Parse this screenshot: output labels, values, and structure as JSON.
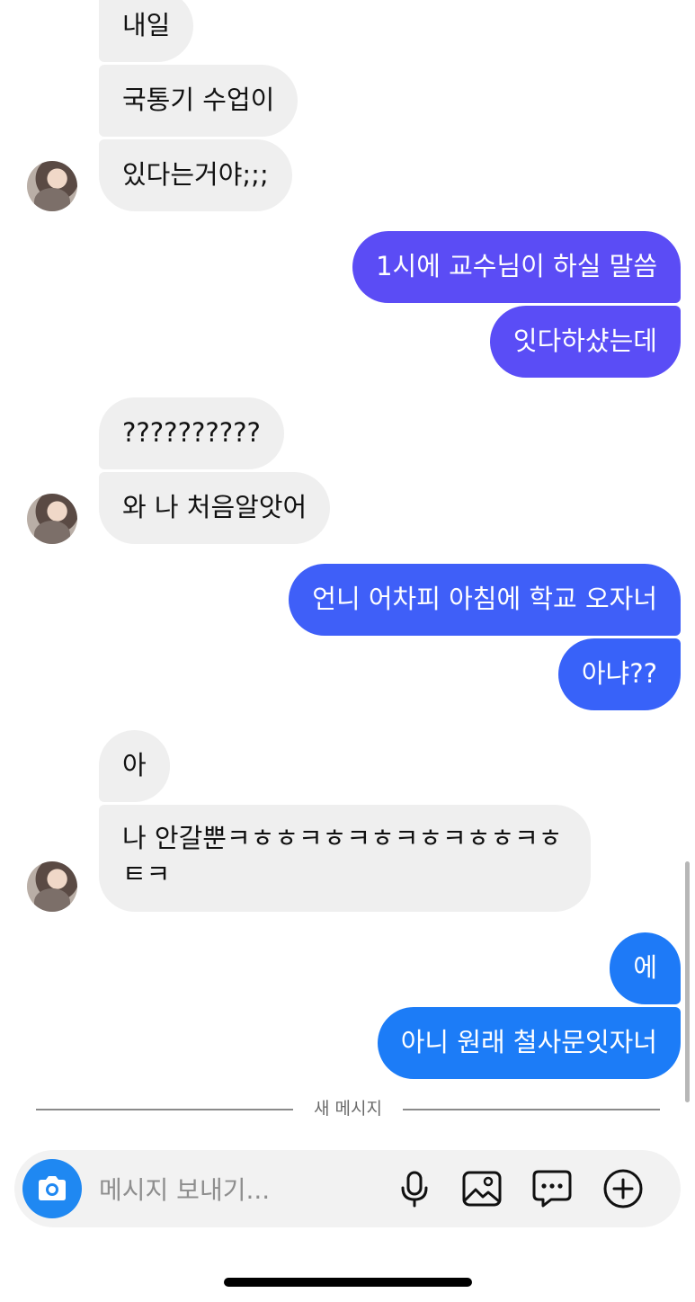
{
  "messages": [
    {
      "side": "in",
      "text": "내일"
    },
    {
      "side": "in",
      "text": "국통기 수업이"
    },
    {
      "side": "in",
      "text": "있다는거야;;;"
    },
    {
      "side": "out",
      "text": "1시에 교수님이 하실 말씀",
      "color": "#5b4cf5"
    },
    {
      "side": "out",
      "text": "잇다하샸는데",
      "color": "#5a4df6"
    },
    {
      "side": "in",
      "text": "??????????"
    },
    {
      "side": "in",
      "text": "와 나 처음알앗어"
    },
    {
      "side": "out",
      "text": "언니 어차피 아침에 학교 오자너",
      "color": "#3f5ff8"
    },
    {
      "side": "out",
      "text": "아냐??",
      "color": "#3862f9"
    },
    {
      "side": "in",
      "text": "아"
    },
    {
      "side": "in",
      "text": "나 안갈뿐ㅋㅎㅎㅋㅎㅋㅎㅋㅎㅋㅎㅎㅋㅎ ㅌㅋ"
    },
    {
      "side": "out",
      "text": "에",
      "color": "#1e7af7"
    },
    {
      "side": "out",
      "text": "아니 원래 철사문잇자너",
      "color": "#1c7cf7"
    }
  ],
  "divider": {
    "label": "새 메시지"
  },
  "composer": {
    "placeholder": "메시지 보내기...",
    "value": ""
  },
  "icons": {
    "camera": "camera-icon",
    "mic": "microphone-icon",
    "gallery": "image-icon",
    "sticker": "chat-bubble-dots-icon",
    "add": "plus-circle-icon"
  },
  "colors": {
    "incoming_bubble": "#efefef",
    "camera_button": "#1f88f2",
    "composer_bg": "#f2f2f2"
  }
}
